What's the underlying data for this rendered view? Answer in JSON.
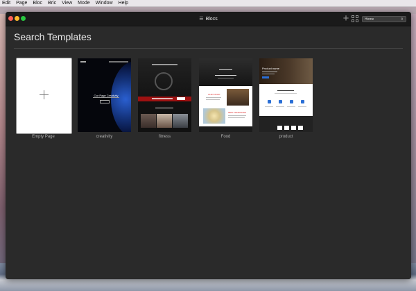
{
  "menubar": {
    "items": [
      "Edit",
      "Page",
      "Bloc",
      "Bric",
      "View",
      "Mode",
      "Window",
      "Help"
    ]
  },
  "window": {
    "title": "Blocs",
    "title_icon": "menu-lines-icon",
    "page_select": "Home",
    "add_icon": "plus-icon",
    "grid_icon": "grid-icon"
  },
  "main": {
    "heading": "Search Templates",
    "templates": [
      {
        "label": "Empty Page"
      },
      {
        "label": "creativity"
      },
      {
        "label": "fitness"
      },
      {
        "label": "Food"
      },
      {
        "label": "product"
      }
    ]
  },
  "thumbnails": {
    "creativity": {
      "hero_text": "Our Page Creativity"
    },
    "product": {
      "hero_text": "Product name"
    },
    "food": {
      "section_a": "OUR STORY",
      "section_b": "NEW TRADITIONS"
    }
  },
  "colors": {
    "window_bg": "#2a2a2a",
    "titlebar_bg": "#1a1a1a",
    "fitness_accent": "#9e1111",
    "product_accent": "#2b6fd6"
  }
}
